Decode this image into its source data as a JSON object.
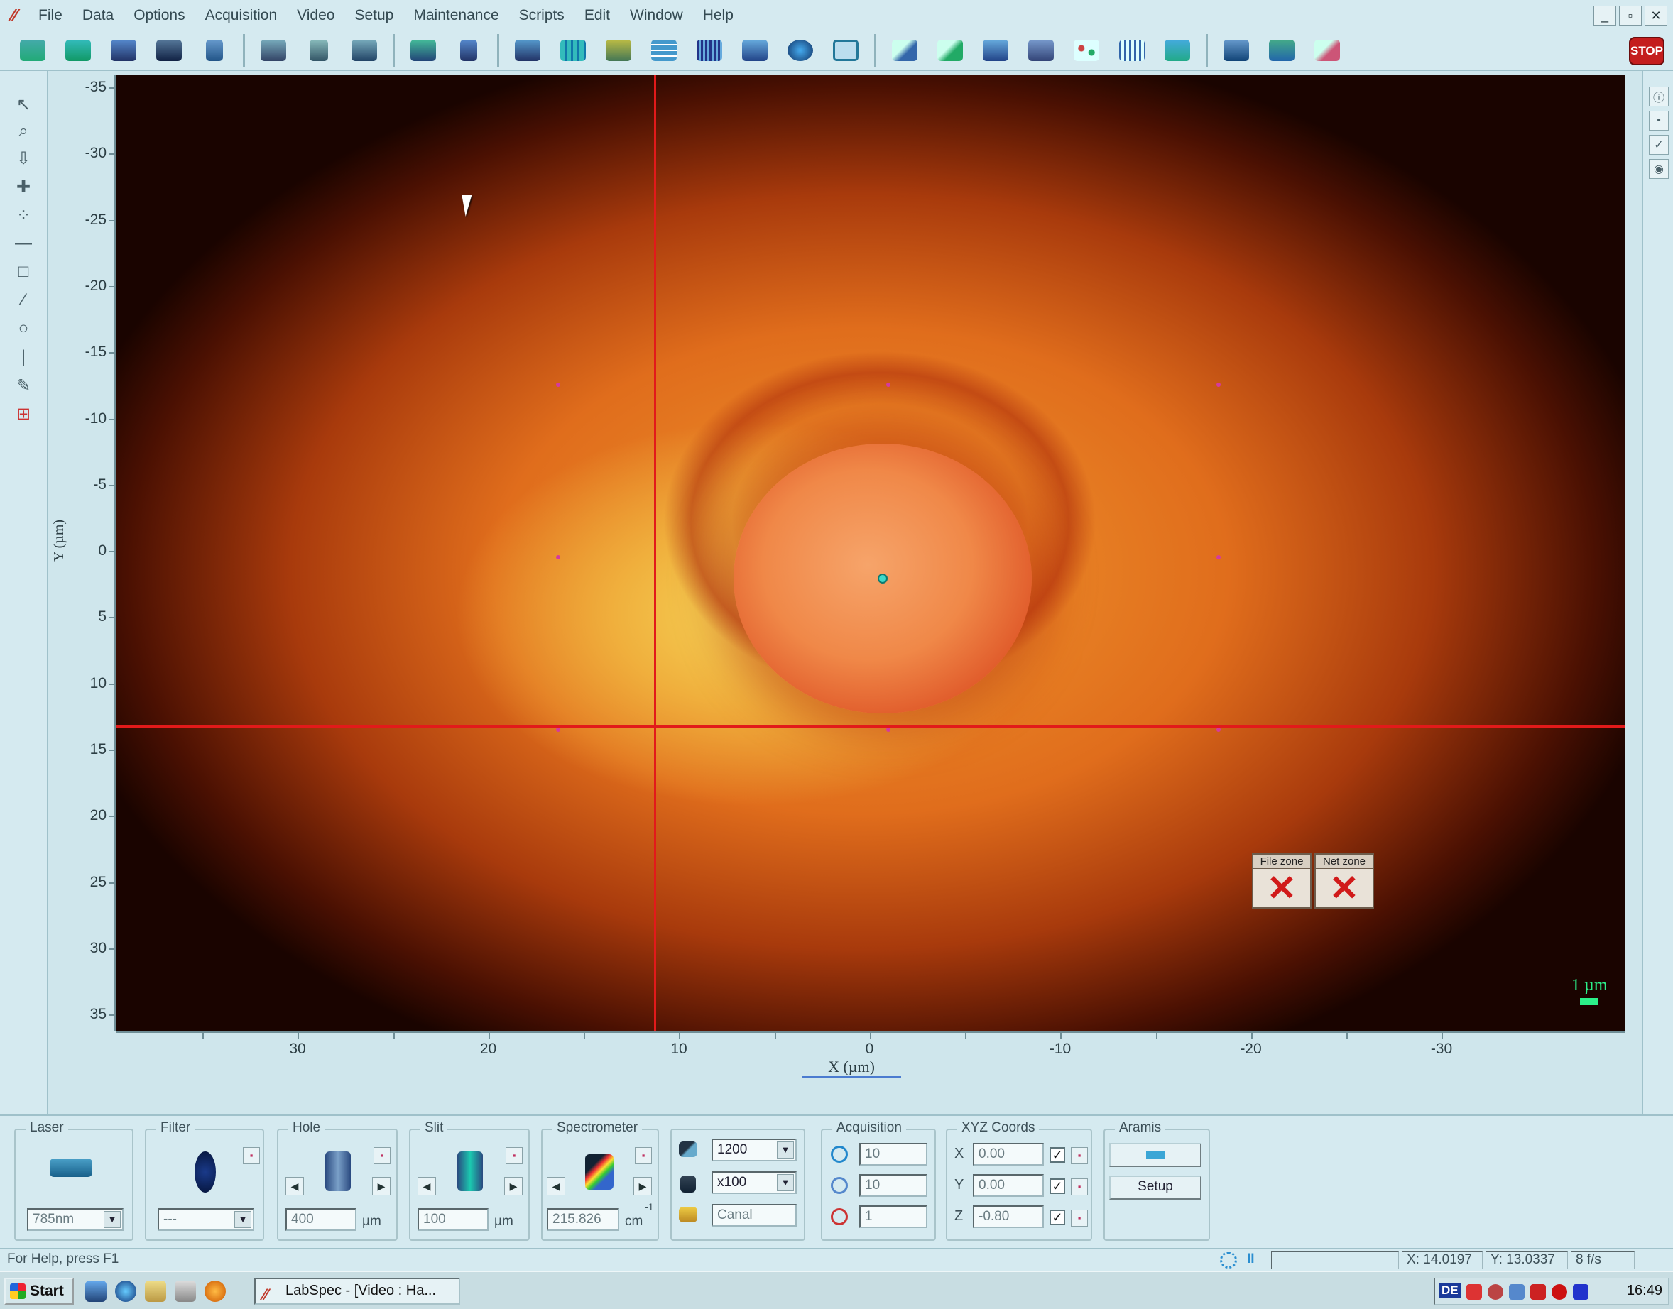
{
  "app": {
    "menu": [
      "File",
      "Data",
      "Options",
      "Acquisition",
      "Video",
      "Setup",
      "Maintenance",
      "Scripts",
      "Edit",
      "Window",
      "Help"
    ],
    "window_controls": [
      "_",
      "▫",
      "✕"
    ],
    "stop_label": "STOP"
  },
  "video": {
    "y_ticks": [
      "-35",
      "-30",
      "-25",
      "-20",
      "-15",
      "-10",
      "-5",
      "0",
      "5",
      "10",
      "15",
      "20",
      "25",
      "30",
      "35"
    ],
    "x_ticks": [
      "30",
      "20",
      "10",
      "0",
      "-10",
      "-20",
      "-30"
    ],
    "x_axis_title": "X (µm)",
    "y_axis_title": "Y (µm)",
    "file_zone_label": "File zone",
    "net_zone_label": "Net zone",
    "zone_x": "✕",
    "scale_label": "1 µm"
  },
  "panel": {
    "laser": {
      "title": "Laser",
      "value": "785nm"
    },
    "filter": {
      "title": "Filter",
      "value": "---"
    },
    "hole": {
      "title": "Hole",
      "value": "400",
      "unit": "µm"
    },
    "slit": {
      "title": "Slit",
      "value": "100",
      "unit": "µm"
    },
    "spectrometer": {
      "title": "Spectrometer",
      "value": "215.826",
      "unit": "cm",
      "unit_exp": "-1"
    },
    "grating": {
      "grating": "1200",
      "objective": "x100",
      "detector": "Canal"
    },
    "acquisition": {
      "title": "Acquisition",
      "time": "10",
      "accum": "10",
      "cycles": "1"
    },
    "xyz": {
      "title": "XYZ Coords",
      "x_label": "X",
      "y_label": "Y",
      "z_label": "Z",
      "x": "0.00",
      "y": "0.00",
      "z": "-0.80"
    },
    "aramis": {
      "title": "Aramis",
      "setup_label": "Setup"
    }
  },
  "status": {
    "help": "For Help, press F1",
    "pause": "II",
    "x_coord": "X: 14.0197",
    "y_coord": "Y: 13.0337",
    "fps": "8 f/s"
  },
  "taskbar": {
    "start": "Start",
    "task": "LabSpec - [Video : Ha...",
    "lang": "DE",
    "clock": "16:49"
  }
}
